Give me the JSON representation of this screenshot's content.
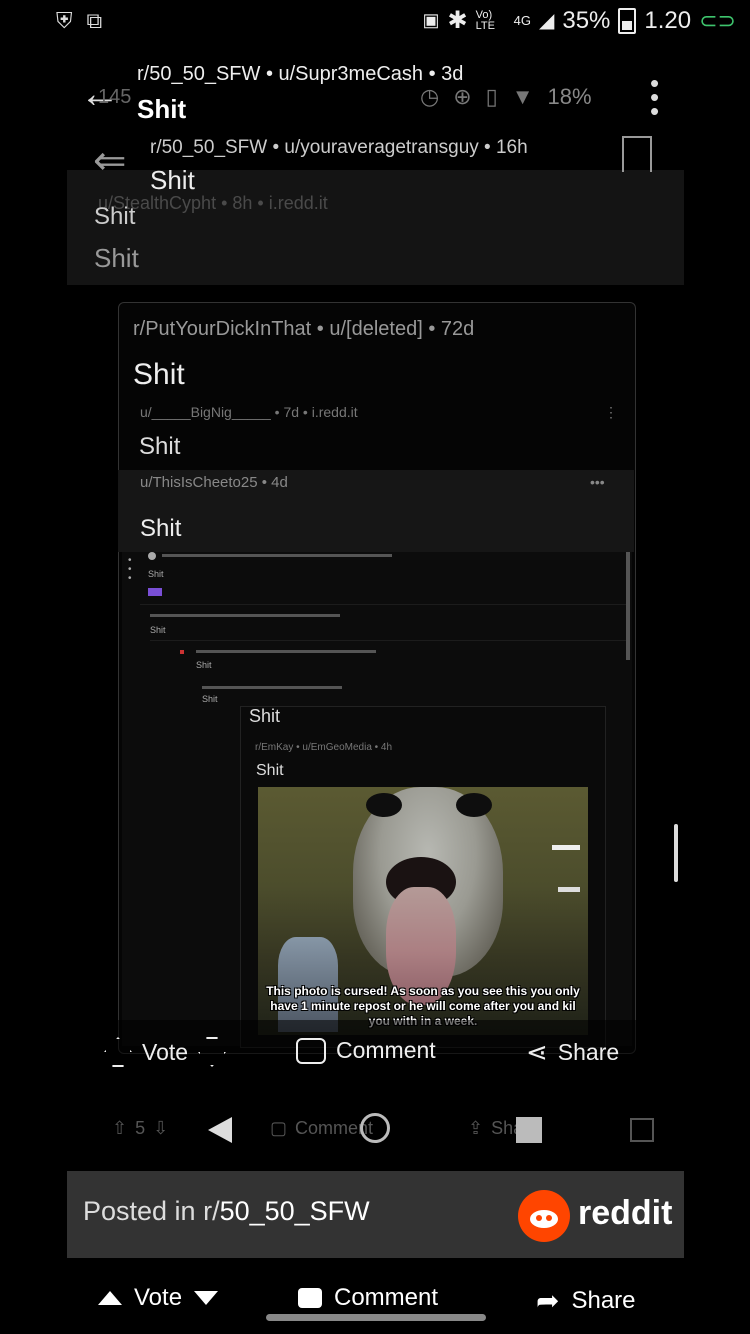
{
  "status_bar": {
    "left_icons": [
      "shield-icon",
      "screenshot-icon"
    ],
    "volte": "Vo) LTE",
    "network": "4G",
    "battery": "35%",
    "time": "1.20"
  },
  "top_post": {
    "meta": "r/50_50_SFW • u/Supr3meCash • 3d",
    "title": "Shit",
    "ghost_count": "145",
    "ghost_battery": "18%"
  },
  "second_post": {
    "meta": "r/50_50_SFW • u/youraveragetransguy • 16h",
    "title": "Shit",
    "ghost_sub": "u/StealthCypht • 8h • i.redd.it",
    "panel_title1": "Shit",
    "panel_title2": "Shit"
  },
  "card": {
    "meta": "r/PutYourDickInThat • u/[deleted] • 72d",
    "title": "Shit",
    "ghost_line": "u/_____BigNig_____ • 7d • i.redd.it",
    "title2": "Shit",
    "meta2": "u/ThisIsCheeto25 • 4d",
    "title3": "Shit",
    "thread_tiny": [
      "Shit",
      "Shit",
      "Shit",
      "Shit"
    ],
    "inner_title": "Shit",
    "inner_meta": "r/EmKay • u/EmGeoMedia • 4h",
    "inner_title2": "Shit",
    "photo_caption": "This photo is cursed! As soon as you see this you only have 1 minute repost or he will come after you and kil you with in a week."
  },
  "card_actions": {
    "vote": "Vote",
    "comment": "Comment",
    "share": "Share"
  },
  "ghost_actions": {
    "count": "5",
    "comment": "Comment",
    "share": "Share"
  },
  "posted_in": {
    "prefix": "Posted in r/",
    "sub": "50_50_SFW",
    "brand": "reddit"
  },
  "bottom_actions": {
    "vote": "Vote",
    "comment": "Comment",
    "share": "Share"
  },
  "colors": {
    "reddit_orange": "#ff4500",
    "charge_green": "#3ec46d"
  }
}
